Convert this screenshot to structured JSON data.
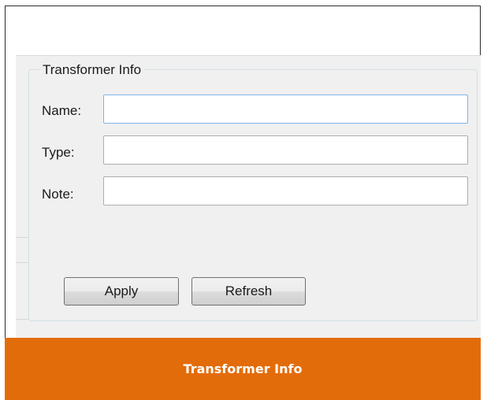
{
  "groupbox": {
    "title": "Transformer Info"
  },
  "fields": [
    {
      "label": "Name:",
      "value": "",
      "placeholder": ""
    },
    {
      "label": "Type:",
      "value": "",
      "placeholder": ""
    },
    {
      "label": "Note:",
      "value": "",
      "placeholder": ""
    }
  ],
  "buttons": {
    "apply_label": "Apply",
    "refresh_label": "Refresh"
  },
  "caption": {
    "text": "Transformer Info"
  },
  "colors": {
    "caption_bar": "#e36c0a",
    "panel_background": "#f0f0f0",
    "focus_border": "#7eb4ea"
  }
}
